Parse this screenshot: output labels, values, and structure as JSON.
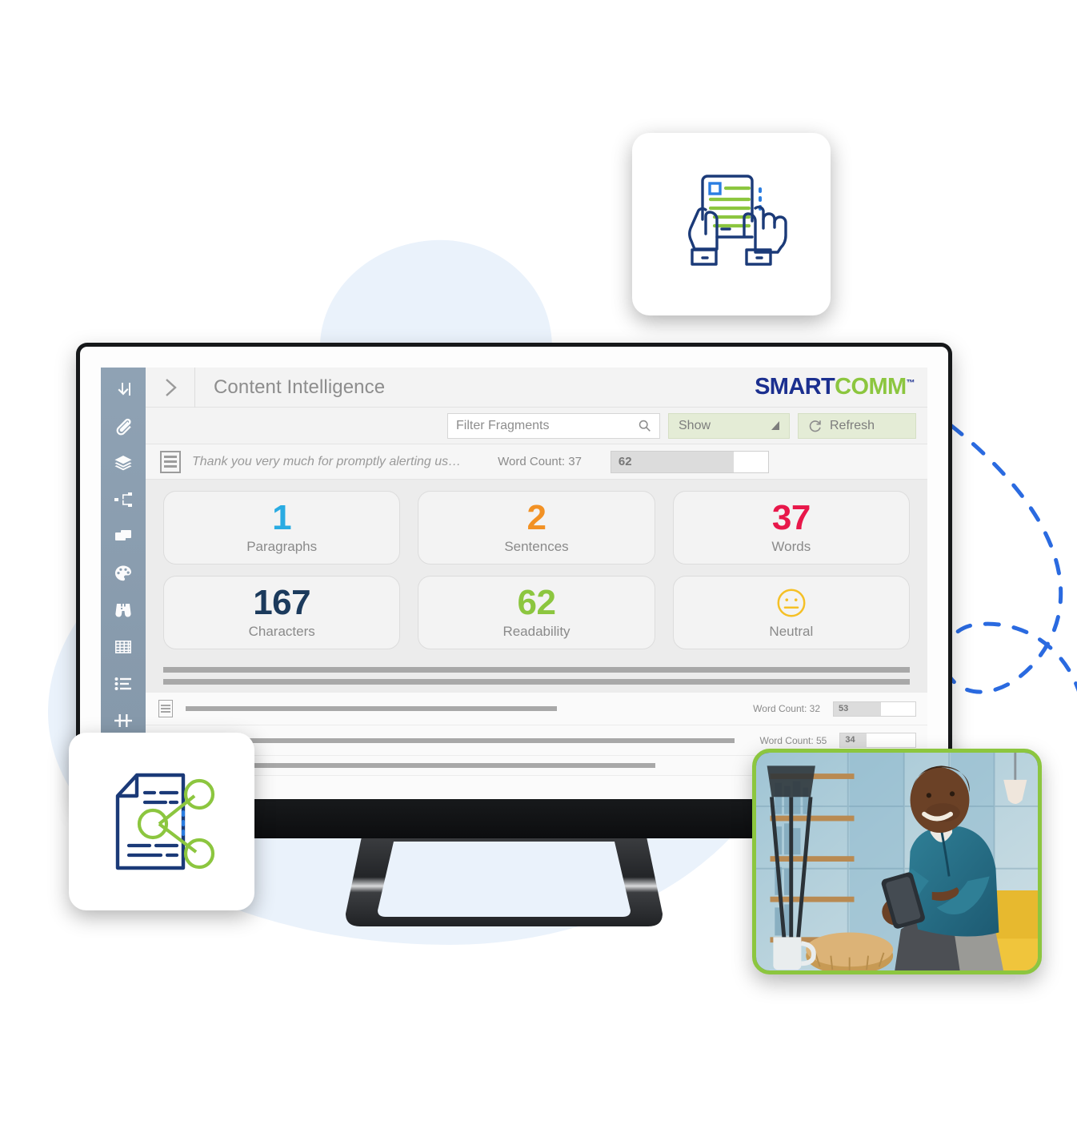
{
  "app": {
    "title": "Content Intelligence",
    "brand": {
      "part1": "SMART",
      "part2": "COMM",
      "tm": "™",
      "color_blue": "#1b2f8f",
      "color_green": "#8cc63f"
    },
    "expand_icon": "chevron-right-icon"
  },
  "sidebar": {
    "items": [
      {
        "icon": "arrow-into-corner-icon",
        "label": "Import"
      },
      {
        "icon": "paperclip-icon",
        "label": "Attachments"
      },
      {
        "icon": "layers-icon",
        "label": "Layers"
      },
      {
        "icon": "hierarchy-nodes-icon",
        "label": "Structure"
      },
      {
        "icon": "copy-stack-icon",
        "label": "Copies"
      },
      {
        "icon": "palette-icon",
        "label": "Styles"
      },
      {
        "icon": "binoculars-icon",
        "label": "Preview"
      },
      {
        "icon": "grid-table-icon",
        "label": "Grid"
      },
      {
        "icon": "bullet-list-icon",
        "label": "List"
      },
      {
        "icon": "merge-fields-icon",
        "label": "Fields"
      }
    ]
  },
  "toolbar": {
    "search_placeholder": "Filter Fragments",
    "search_value": "",
    "search_icon": "search-icon",
    "show_label": "Show",
    "show_caret_icon": "triangle-down-icon",
    "refresh_label": "Refresh",
    "refresh_icon": "refresh-icon",
    "button_bg": "#e4ecd6"
  },
  "fragment_row": {
    "doc_icon": "document-lines-icon",
    "text": "Thank you very much for promptly alerting us…",
    "word_count_label": "Word Count: 37",
    "meter_value": "62",
    "meter_percent": 78
  },
  "stats": [
    {
      "value": "1",
      "label": "Paragraphs",
      "color": "#29abe2"
    },
    {
      "value": "2",
      "label": "Sentences",
      "color": "#f29124"
    },
    {
      "value": "37",
      "label": "Words",
      "color": "#e8174a"
    },
    {
      "value": "167",
      "label": "Characters",
      "color": "#1b3a5c"
    },
    {
      "value": "62",
      "label": "Readability",
      "color": "#8cc63f"
    },
    {
      "value": "",
      "label": "Neutral",
      "color": "#f5c026",
      "icon": "neutral-face-icon"
    }
  ],
  "bottom_rows": [
    {
      "doc_icon": "document-lines-icon",
      "line_width_pct": 49,
      "word_count_label": "Word Count: 32",
      "meter_value": "53",
      "meter_percent": 58
    },
    {
      "doc_icon": "",
      "line_width_pct": 79,
      "word_count_label": "Word Count: 55",
      "meter_value": "34",
      "meter_percent": 35
    }
  ],
  "decorations": {
    "tile_top_icon": "hands-holding-document-icon",
    "tile_bottom_icon": "document-share-icon",
    "dashed_curve": "dashed-loop-line",
    "blob_color": "#eaf2fb",
    "dash_color": "#2a6ae0"
  },
  "photo": {
    "alt": "man-using-smartphone-photo",
    "border_color": "#8cc63f"
  }
}
